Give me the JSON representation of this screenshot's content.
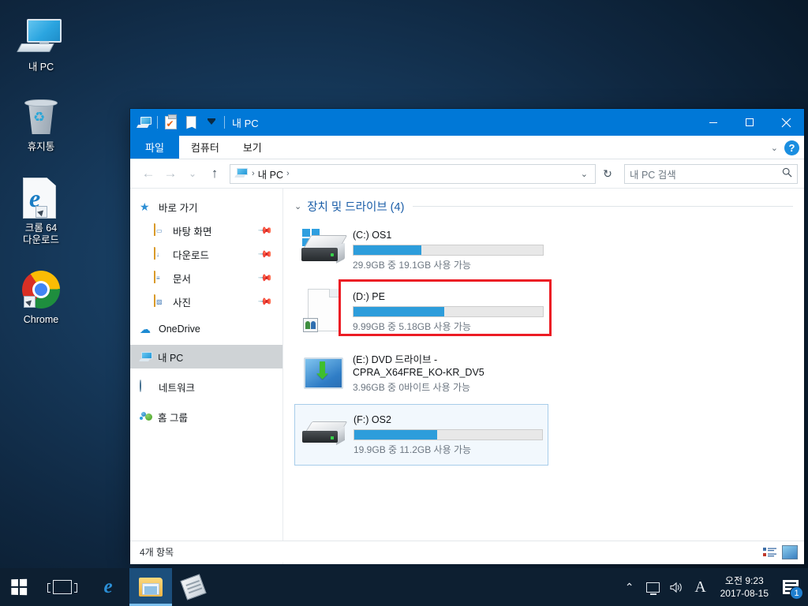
{
  "desktop": {
    "icons": [
      {
        "label": "내 PC",
        "icon": "my-computer-icon"
      },
      {
        "label": "휴지통",
        "icon": "recycle-bin-icon"
      },
      {
        "label": "크롬 64\n다운로드",
        "label_line1": "크롬 64",
        "label_line2": "다운로드",
        "icon": "edge-document-shortcut-icon"
      },
      {
        "label": "Chrome",
        "icon": "chrome-icon"
      }
    ]
  },
  "window": {
    "title": "내 PC",
    "quick_access": [
      "computer-icon",
      "properties-icon",
      "new-folder-icon",
      "customize-dropdown-icon"
    ],
    "controls": {
      "minimize": "–",
      "maximize": "□",
      "close": "✕"
    },
    "ribbon": {
      "tabs": [
        {
          "label": "파일",
          "active": true
        },
        {
          "label": "컴퓨터",
          "active": false
        },
        {
          "label": "보기",
          "active": false
        }
      ],
      "expand_label": "⌄",
      "help_label": "?"
    },
    "nav": {
      "back": "←",
      "forward": "→",
      "recent": "⌄",
      "up": "↑",
      "address_crumbs": [
        "내 PC"
      ],
      "address_separator": "›",
      "address_dropdown": "⌄",
      "refresh": "↻"
    },
    "search": {
      "placeholder": "내 PC 검색",
      "icon": "search-icon"
    },
    "sidebar": [
      {
        "label": "바로 가기",
        "icon": "quick-access-star-icon",
        "level": 0,
        "pinned": false,
        "selected": false
      },
      {
        "label": "바탕 화면",
        "icon": "desktop-folder-icon",
        "level": 1,
        "pinned": true,
        "selected": false
      },
      {
        "label": "다운로드",
        "icon": "downloads-folder-icon",
        "level": 1,
        "pinned": true,
        "selected": false
      },
      {
        "label": "문서",
        "icon": "documents-folder-icon",
        "level": 1,
        "pinned": true,
        "selected": false
      },
      {
        "label": "사진",
        "icon": "pictures-folder-icon",
        "level": 1,
        "pinned": true,
        "selected": false
      },
      {
        "label": "OneDrive",
        "icon": "onedrive-cloud-icon",
        "level": 0,
        "pinned": false,
        "selected": false
      },
      {
        "label": "내 PC",
        "icon": "this-pc-icon",
        "level": 0,
        "pinned": false,
        "selected": true
      },
      {
        "label": "네트워크",
        "icon": "network-icon",
        "level": 0,
        "pinned": false,
        "selected": false
      },
      {
        "label": "홈 그룹",
        "icon": "homegroup-icon",
        "level": 0,
        "pinned": false,
        "selected": false
      }
    ],
    "content": {
      "group_title": "장치 및 드라이브 (4)",
      "group_chevron": "⌄",
      "drives": [
        {
          "name": "(C:) OS1",
          "capacity_text": "29.9GB 중 19.1GB 사용 가능",
          "used_percent": 36,
          "icon": "windows-local-disk-icon",
          "selected": false,
          "annotated": false
        },
        {
          "name": "(D:) PE",
          "capacity_text": "9.99GB 중 5.18GB 사용 가능",
          "used_percent": 48,
          "icon": "generic-shared-document-icon",
          "selected": false,
          "annotated": true
        },
        {
          "name": "(E:) DVD 드라이브 - CPRA_X64FRE_KO-KR_DV5",
          "name_line1": "(E:) DVD 드라이브 -",
          "name_line2": "CPRA_X64FRE_KO-KR_DV5",
          "capacity_text": "3.96GB 중 0바이트 사용 가능",
          "used_percent": 100,
          "icon": "dvd-drive-icon",
          "selected": false,
          "annotated": false,
          "has_bar": false
        },
        {
          "name": "(F:) OS2",
          "capacity_text": "19.9GB 중 11.2GB 사용 가능",
          "used_percent": 44,
          "icon": "external-disk-icon",
          "selected": true,
          "annotated": false
        }
      ]
    },
    "status": {
      "item_count": "4개 항목",
      "view_buttons": [
        {
          "name": "details-view-button",
          "icon": "details-view-icon"
        },
        {
          "name": "large-icons-view-button",
          "icon": "large-icons-view-icon"
        }
      ]
    }
  },
  "taskbar": {
    "start": "start-button",
    "items": [
      {
        "name": "task-view-button",
        "icon": "task-view-icon",
        "active": false
      },
      {
        "name": "taskbar-edge",
        "icon": "edge-icon",
        "active": false
      },
      {
        "name": "taskbar-file-explorer",
        "icon": "file-explorer-icon",
        "active": true
      },
      {
        "name": "taskbar-sticky-notes",
        "icon": "sticky-notes-icon",
        "active": false
      }
    ],
    "tray": {
      "overflow": "⌃",
      "network": "network-icon",
      "volume": "volume-icon",
      "input_language": "A",
      "time": "오전 9:23",
      "date": "2017-08-15",
      "notification_count": "1"
    }
  },
  "colors": {
    "accent": "#0078d7",
    "bar_fill": "#2d9ddb",
    "annotation_red": "#ec1c24",
    "group_title": "#1b5ea8",
    "selection": "#cfd3d6"
  }
}
